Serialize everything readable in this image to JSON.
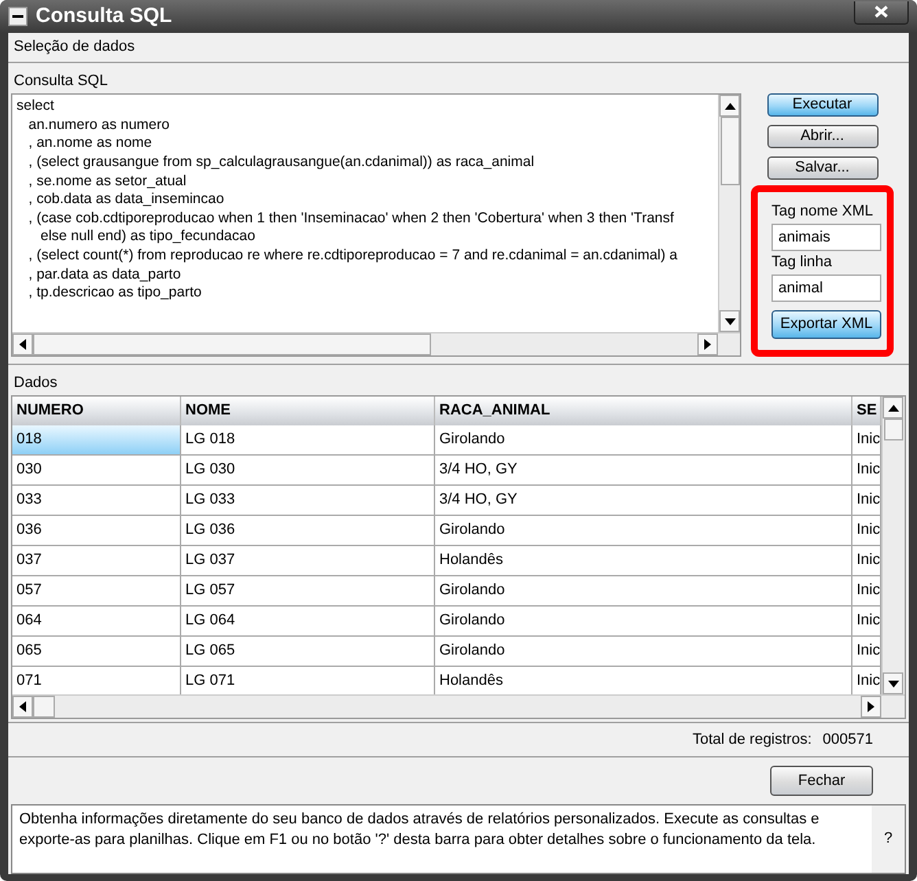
{
  "window": {
    "title": "Consulta SQL"
  },
  "section_title": "Seleção de dados",
  "sql": {
    "label": "Consulta SQL",
    "lines": [
      "select",
      "   an.numero as numero",
      "   , an.nome as nome",
      "   , (select grausangue from sp_calculagrausangue(an.cdanimal)) as raca_animal",
      "   , se.nome as setor_atual",
      "   , cob.data as data_insemincao",
      "   , (case cob.cdtiporeproducao when 1 then 'Inseminacao' when 2 then 'Cobertura' when 3 then 'Transf",
      "      else null end) as tipo_fecundacao",
      "   , (select count(*) from reproducao re where re.cdtiporeproducao = 7 and re.cdanimal = an.cdanimal) a",
      "   , par.data as data_parto",
      "   , tp.descricao as tipo_parto"
    ]
  },
  "actions": [
    {
      "label": "Executar",
      "primary": true
    },
    {
      "label": "Abrir...",
      "primary": false
    },
    {
      "label": "Salvar...",
      "primary": false
    }
  ],
  "xml_export": {
    "highlighted": true,
    "fields": [
      {
        "label": "Tag nome XML",
        "value": "animais"
      },
      {
        "label": "Tag linha",
        "value": "animal"
      }
    ],
    "button": "Exportar XML"
  },
  "data": {
    "label": "Dados",
    "columns": [
      "NUMERO",
      "NOME",
      "RACA_ANIMAL",
      "SE"
    ],
    "rows": [
      {
        "cells": [
          "018",
          "LG 018",
          "Girolando",
          "Inic"
        ],
        "selected": true
      },
      {
        "cells": [
          "030",
          "LG 030",
          "3/4 HO, GY",
          "Inic"
        ],
        "selected": false
      },
      {
        "cells": [
          "033",
          "LG 033",
          "3/4 HO, GY",
          "Inic"
        ],
        "selected": false
      },
      {
        "cells": [
          "036",
          "LG 036",
          "Girolando",
          "Inic"
        ],
        "selected": false
      },
      {
        "cells": [
          "037",
          "LG 037",
          "Holandês",
          "Inic"
        ],
        "selected": false
      },
      {
        "cells": [
          "057",
          "LG 057",
          "Girolando",
          "Inic"
        ],
        "selected": false
      },
      {
        "cells": [
          "064",
          "LG 064",
          "Girolando",
          "Inic"
        ],
        "selected": false
      },
      {
        "cells": [
          "065",
          "LG 065",
          "Girolando",
          "Inic"
        ],
        "selected": false
      },
      {
        "cells": [
          "071",
          "LG 071",
          "Holandês",
          "Inic"
        ],
        "selected": false
      }
    ]
  },
  "total": {
    "label": "Total de registros:",
    "value": "000571"
  },
  "close_button": "Fechar",
  "help": {
    "text": "Obtenha informações diretamente do seu banco de dados através de relatórios personalizados. Execute as consultas e exporte-as para planilhas. Clique em F1 ou no botão '?' desta barra para obter detalhes sobre o funcionamento da tela.",
    "button": "?"
  }
}
